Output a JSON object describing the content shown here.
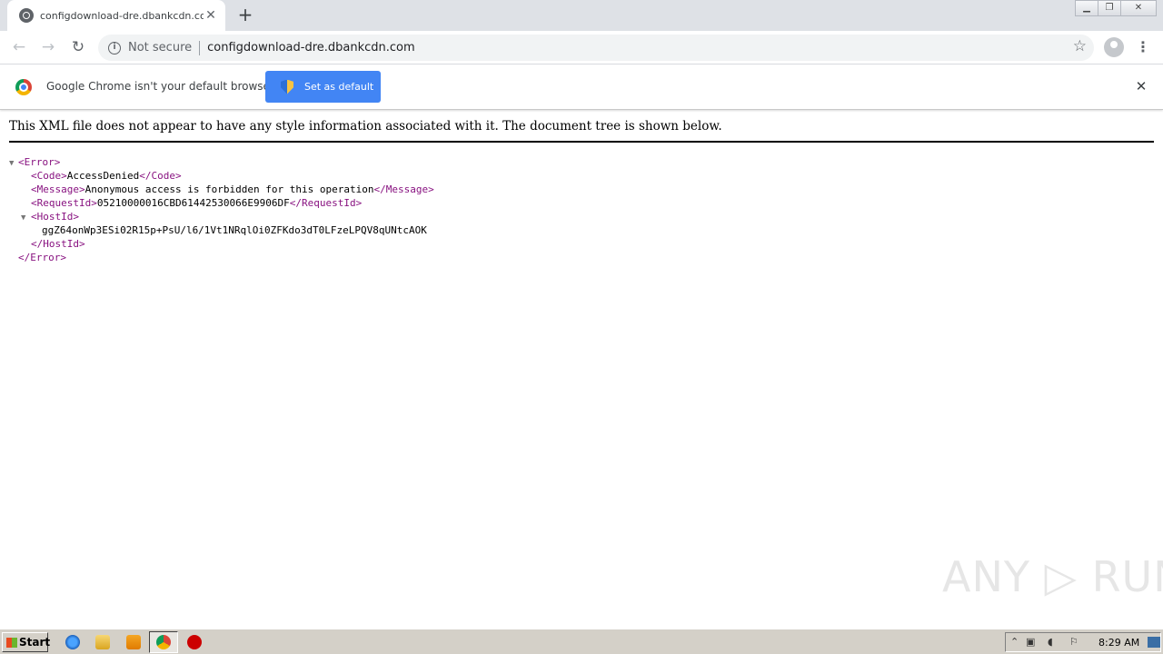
{
  "browser": {
    "tab_title": "configdownload-dre.dbankcdn.com",
    "tab_close": "✕",
    "new_tab": "+",
    "not_secure": "Not secure",
    "url": "configdownload-dre.dbankcdn.com",
    "back": "←",
    "forward": "→",
    "reload": "↻",
    "star": "☆",
    "menu": "⋮"
  },
  "window_controls": {
    "minimize": "▁",
    "maximize": "❐",
    "close": "✕"
  },
  "infobar": {
    "text": "Google Chrome isn't your default browser",
    "button": "Set as default",
    "close": "✕"
  },
  "xml": {
    "header": "This XML file does not appear to have any style information associated with it. The document tree is shown below.",
    "error_open": "<Error>",
    "error_close": "</Error>",
    "code_open": "<Code>",
    "code_value": "AccessDenied",
    "code_close": "</Code>",
    "message_open": "<Message>",
    "message_value": "Anonymous access is forbidden for this operation",
    "message_close": "</Message>",
    "requestid_open": "<RequestId>",
    "requestid_value": "05210000016CBD61442530066E9906DF",
    "requestid_close": "</RequestId>",
    "hostid_open": "<HostId>",
    "hostid_value": "ggZ64onWp3ESi02R15p+PsU/l6/1Vt1NRqlOi0ZFKdo3dT0LFzeLPQV8qUNtcAOK",
    "hostid_close": "</HostId>",
    "triangle": "▼"
  },
  "watermark": "ANY ▷ RUN",
  "taskbar": {
    "start": "Start",
    "clock": "8:29 AM",
    "icons": [
      "ie-icon",
      "folder-icon",
      "media-player-icon",
      "chrome-icon",
      "stop-icon"
    ]
  },
  "colors": {
    "infobar_button": "#4285f4",
    "xml_tag": "#881280",
    "titlebar": "#dee1e6"
  }
}
